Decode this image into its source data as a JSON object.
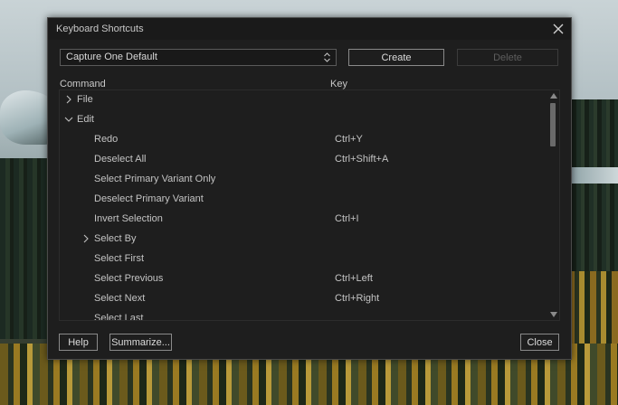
{
  "window": {
    "title": "Keyboard Shortcuts"
  },
  "preset": {
    "selected": "Capture One Default"
  },
  "toolbar": {
    "create_label": "Create",
    "delete_label": "Delete"
  },
  "columns": {
    "command": "Command",
    "key": "Key"
  },
  "rows": [
    {
      "label": "File",
      "key": "",
      "expand": "collapsed",
      "depth": 0
    },
    {
      "label": "Edit",
      "key": "",
      "expand": "expanded",
      "depth": 0
    },
    {
      "label": "Redo",
      "key": "Ctrl+Y",
      "expand": "none",
      "depth": 1
    },
    {
      "label": "Deselect All",
      "key": "Ctrl+Shift+A",
      "expand": "none",
      "depth": 1
    },
    {
      "label": "Select Primary Variant Only",
      "key": "",
      "expand": "none",
      "depth": 1
    },
    {
      "label": "Deselect Primary Variant",
      "key": "",
      "expand": "none",
      "depth": 1
    },
    {
      "label": "Invert Selection",
      "key": "Ctrl+I",
      "expand": "none",
      "depth": 1
    },
    {
      "label": "Select By",
      "key": "",
      "expand": "collapsed",
      "depth": 1
    },
    {
      "label": "Select First",
      "key": "",
      "expand": "none",
      "depth": 1
    },
    {
      "label": "Select Previous",
      "key": "Ctrl+Left",
      "expand": "none",
      "depth": 1
    },
    {
      "label": "Select Next",
      "key": "Ctrl+Right",
      "expand": "none",
      "depth": 1
    },
    {
      "label": "Select Last",
      "key": "",
      "expand": "none",
      "depth": 1
    }
  ],
  "footer": {
    "help_label": "Help",
    "summarize_label": "Summarize...",
    "close_label": "Close"
  },
  "icons": {
    "close": "close-icon",
    "select_arrows": "chevron-up-down-icon",
    "collapsed": "chevron-right-icon",
    "expanded": "chevron-down-icon",
    "scroll_up": "scroll-up-icon",
    "scroll_down": "scroll-down-icon"
  }
}
